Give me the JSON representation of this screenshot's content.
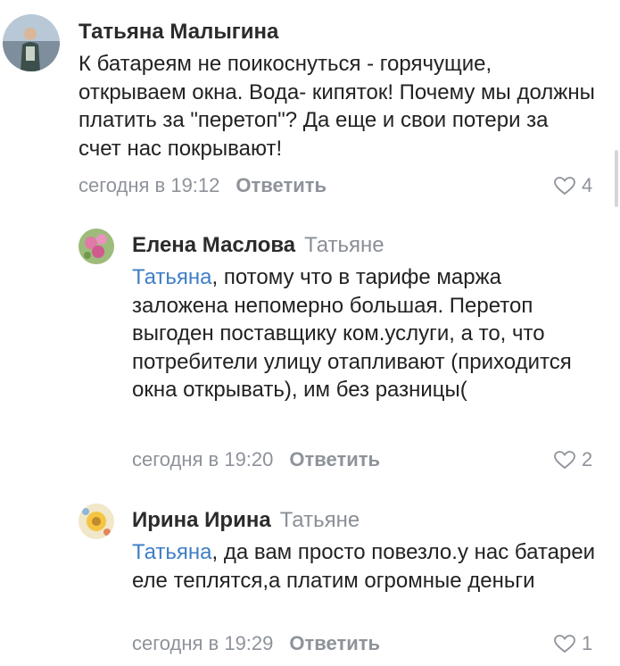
{
  "comments": [
    {
      "author": "Татьяна Малыгина",
      "reply_to": "",
      "mention": "",
      "text": "К батареям не поикоснуться - горячущие, открываем окна. Вода- кипяток! Почему мы должны платить за \"перетоп\"? Да еще и свои потери за счет нас покрывают!",
      "time": "сегодня в 19:12",
      "reply_label": "Ответить",
      "likes": "4"
    },
    {
      "author": "Елена Маслова",
      "reply_to": "Татьяне",
      "mention": "Татьяна",
      "text": ", потому что в тарифе маржа заложена непомерно большая. Перетоп выгоден поставщику ком.услуги, а то, что потребители улицу отапливают (приходится окна открывать), им без разницы(",
      "time": "сегодня в 19:20",
      "reply_label": "Ответить",
      "likes": "2"
    },
    {
      "author": "Ирина Ирина",
      "reply_to": "Татьяне",
      "mention": "Татьяна",
      "text": ", да вам просто повезло.у нас батареи еле теплятся,а платим огромные деньги",
      "time": "сегодня в 19:29",
      "reply_label": "Ответить",
      "likes": "1"
    }
  ],
  "icons": {
    "like": "heart-outline-icon"
  },
  "colors": {
    "mention": "#3f7ec7",
    "meta": "#8e939a"
  }
}
